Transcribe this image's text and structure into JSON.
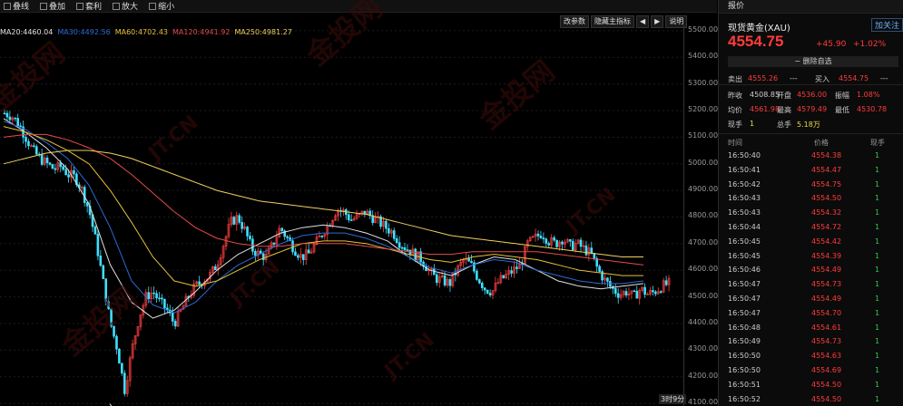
{
  "toolbar": {
    "items": [
      {
        "label": "叠线",
        "icon": "line-icon"
      },
      {
        "label": "叠加",
        "icon": "overlay-icon"
      },
      {
        "label": "套利",
        "icon": "arbitrage-icon"
      },
      {
        "label": "放大",
        "icon": "zoom-in-icon"
      },
      {
        "label": "缩小",
        "icon": "zoom-out-icon"
      }
    ]
  },
  "chart_buttons": {
    "params": "改参数",
    "hide_indicator": "隐藏主指标",
    "left": "◀",
    "right": "▶",
    "help": "说明"
  },
  "ma_legend": [
    {
      "label": "MA20:4460.04",
      "color": "#e0e0e0"
    },
    {
      "label": "MA30:4492.56",
      "color": "#2a6bd6"
    },
    {
      "label": "MA60:4702.43",
      "color": "#e8c03a"
    },
    {
      "label": "MA120:4941.92",
      "color": "#e44b4b"
    },
    {
      "label": "MA250:4981.27",
      "color": "#f0d060"
    }
  ],
  "price_axis": [
    "5500.00",
    "5400.00",
    "5300.00",
    "5200.00",
    "5100.00",
    "5000.00",
    "4900.00",
    "4800.00",
    "4700.00",
    "4600.00",
    "4500.00",
    "4400.00",
    "4300.00",
    "4200.00",
    "4100.00"
  ],
  "min_label": "4097.99",
  "time_badge": "3时9分",
  "watermark": [
    "金投网",
    "JT.CN"
  ],
  "panel": {
    "title": "报价",
    "name": "现货黄金(XAU)",
    "follow": "加关注",
    "price": "4554.75",
    "change": "+45.90",
    "change_pct": "+1.02%",
    "delete_label": "删除自选",
    "bid_label": "卖出",
    "bid": "4555.26",
    "bid_sep": "---",
    "ask_label": "买入",
    "ask": "4554.75",
    "ask_sep": "---",
    "rows": [
      [
        {
          "l": "昨收",
          "v": "4508.85",
          "c": "white"
        },
        {
          "l": "开盘",
          "v": "4536.00",
          "c": "red"
        },
        {
          "l": "振幅",
          "v": "1.08%",
          "c": "red"
        }
      ],
      [
        {
          "l": "均价",
          "v": "4561.98",
          "c": "red"
        },
        {
          "l": "最高",
          "v": "4579.49",
          "c": "red"
        },
        {
          "l": "最低",
          "v": "4530.78",
          "c": "red"
        }
      ],
      [
        {
          "l": "现手",
          "v": "1",
          "c": "yellow"
        },
        {
          "l": "总手",
          "v": "5.18万",
          "c": "yellow"
        }
      ]
    ],
    "tick_headers": [
      "时间",
      "价格",
      "现手"
    ],
    "ticks": [
      {
        "t": "16:50:40",
        "p": "4554.38",
        "v": "1"
      },
      {
        "t": "16:50:41",
        "p": "4554.47",
        "v": "1"
      },
      {
        "t": "16:50:42",
        "p": "4554.75",
        "v": "1"
      },
      {
        "t": "16:50:43",
        "p": "4554.50",
        "v": "1"
      },
      {
        "t": "16:50:43",
        "p": "4554.32",
        "v": "1"
      },
      {
        "t": "16:50:44",
        "p": "4554.72",
        "v": "1"
      },
      {
        "t": "16:50:45",
        "p": "4554.42",
        "v": "1"
      },
      {
        "t": "16:50:45",
        "p": "4554.39",
        "v": "1"
      },
      {
        "t": "16:50:46",
        "p": "4554.49",
        "v": "1"
      },
      {
        "t": "16:50:47",
        "p": "4554.73",
        "v": "1"
      },
      {
        "t": "16:50:47",
        "p": "4554.49",
        "v": "1"
      },
      {
        "t": "16:50:47",
        "p": "4554.70",
        "v": "1"
      },
      {
        "t": "16:50:48",
        "p": "4554.61",
        "v": "1"
      },
      {
        "t": "16:50:49",
        "p": "4554.73",
        "v": "1"
      },
      {
        "t": "16:50:50",
        "p": "4554.63",
        "v": "1"
      },
      {
        "t": "16:50:50",
        "p": "4554.69",
        "v": "1"
      },
      {
        "t": "16:50:51",
        "p": "4554.50",
        "v": "1"
      },
      {
        "t": "16:50:52",
        "p": "4554.50",
        "v": "1"
      }
    ]
  },
  "chart_data": {
    "type": "candlestick",
    "ylim": [
      4090,
      5520
    ],
    "price_path": [
      5190,
      5180,
      5150,
      5100,
      5050,
      5020,
      5000,
      4980,
      4990,
      4960,
      4950,
      4900,
      4820,
      4700,
      4550,
      4400,
      4300,
      4150,
      4300,
      4420,
      4500,
      4520,
      4480,
      4450,
      4400,
      4450,
      4500,
      4540,
      4560,
      4580,
      4620,
      4700,
      4780,
      4800,
      4750,
      4680,
      4660,
      4650,
      4700,
      4760,
      4720,
      4680,
      4650,
      4660,
      4700,
      4740,
      4780,
      4830,
      4820,
      4790,
      4800,
      4820,
      4800,
      4780,
      4760,
      4740,
      4700,
      4680,
      4660,
      4640,
      4600,
      4570,
      4560,
      4550,
      4600,
      4640,
      4620,
      4570,
      4530,
      4520,
      4560,
      4580,
      4600,
      4620,
      4700,
      4720,
      4740,
      4710,
      4700,
      4720,
      4690,
      4700,
      4680,
      4660,
      4600,
      4560,
      4530,
      4510,
      4520,
      4500,
      4530,
      4510,
      4520,
      4540,
      4550
    ],
    "ma_levels": {
      "MA20": [
        5170,
        5120,
        5060,
        4980,
        4850,
        4620,
        4480,
        4420,
        4450,
        4520,
        4600,
        4660,
        4700,
        4740,
        4760,
        4770,
        4760,
        4740,
        4710,
        4650,
        4600,
        4580,
        4620,
        4650,
        4640,
        4600,
        4560,
        4540,
        4530,
        4540,
        4550
      ],
      "MA30": [
        5160,
        5130,
        5080,
        5020,
        4920,
        4760,
        4560,
        4470,
        4440,
        4480,
        4560,
        4620,
        4660,
        4700,
        4730,
        4740,
        4740,
        4720,
        4690,
        4650,
        4610,
        4590,
        4620,
        4640,
        4630,
        4600,
        4580,
        4560,
        4550,
        4550,
        4560
      ],
      "MA60": [
        5140,
        5120,
        5090,
        5050,
        5000,
        4900,
        4780,
        4650,
        4560,
        4540,
        4560,
        4600,
        4640,
        4670,
        4700,
        4710,
        4710,
        4700,
        4680,
        4660,
        4640,
        4630,
        4650,
        4660,
        4650,
        4640,
        4620,
        4600,
        4590,
        4580,
        4580
      ],
      "MA120": [
        5100,
        5110,
        5110,
        5090,
        5060,
        5020,
        4960,
        4890,
        4820,
        4760,
        4720,
        4700,
        4690,
        4690,
        4700,
        4700,
        4700,
        4690,
        4680,
        4670,
        4660,
        4660,
        4670,
        4670,
        4670,
        4670,
        4660,
        4650,
        4640,
        4630,
        4620
      ],
      "MA250": [
        5000,
        5020,
        5040,
        5050,
        5050,
        5040,
        5020,
        4990,
        4960,
        4930,
        4900,
        4880,
        4860,
        4850,
        4840,
        4830,
        4820,
        4810,
        4790,
        4770,
        4750,
        4730,
        4720,
        4710,
        4700,
        4690,
        4680,
        4670,
        4660,
        4650,
        4650
      ]
    }
  }
}
